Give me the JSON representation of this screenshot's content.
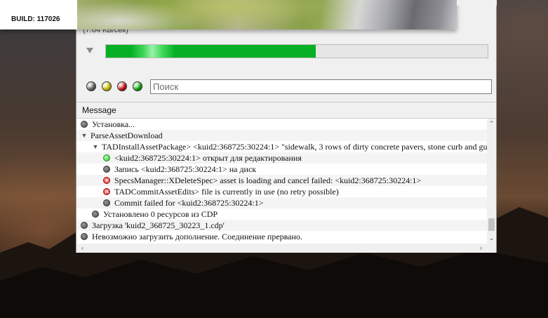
{
  "preview": {
    "build_label": "BUILD: 117026"
  },
  "download": {
    "speed_text": "(7.64 КБ/сек)",
    "progress_fraction": 0.55
  },
  "filters": {
    "dots": [
      {
        "name": "filter-gray-button",
        "color": "#6e6e6e"
      },
      {
        "name": "filter-yellow-button",
        "color": "#e8d800"
      },
      {
        "name": "filter-red-button",
        "color": "#e01010"
      },
      {
        "name": "filter-green-button",
        "color": "#10c010"
      }
    ]
  },
  "search": {
    "placeholder": "Поиск",
    "value": ""
  },
  "log": {
    "column_header": "Message",
    "rows": [
      {
        "indent": 0,
        "toggle": "",
        "status": "gray",
        "text": "Установка..."
      },
      {
        "indent": 0,
        "toggle": "down",
        "status": "",
        "text": "ParseAssetDownload"
      },
      {
        "indent": 1,
        "toggle": "down",
        "status": "",
        "text": "TADInstallAssetPackage> <kuid2:368725:30224:1> \"sidewalk, 3 rows of dirty concrete pavers, stone curb and gu"
      },
      {
        "indent": 2,
        "toggle": "",
        "status": "green",
        "text": "<kuid2:368725:30224:1> открыт для редактирования"
      },
      {
        "indent": 2,
        "toggle": "",
        "status": "gray",
        "text": "Запись <kuid2:368725:30224:1> на диск"
      },
      {
        "indent": 2,
        "toggle": "",
        "status": "red",
        "text": "SpecsManager::XDeleteSpec> asset is loading and cancel failed: <kuid2:368725:30224:1>"
      },
      {
        "indent": 2,
        "toggle": "",
        "status": "red",
        "text": "TADCommitAssetEdits> file is currently in use (no retry possible)"
      },
      {
        "indent": 2,
        "toggle": "",
        "status": "gray",
        "text": "Commit failed for <kuid2:368725:30224:1>"
      },
      {
        "indent": 1,
        "toggle": "",
        "status": "gray",
        "text": "Установлено 0 ресурсов из CDP"
      },
      {
        "indent": 0,
        "toggle": "",
        "status": "gray",
        "text": "Загрузка 'kuid2_368725_30223_1.cdp'"
      },
      {
        "indent": 0,
        "toggle": "",
        "status": "gray",
        "text": "Невозможно загрузить дополнение. Соединение прервано."
      }
    ]
  }
}
